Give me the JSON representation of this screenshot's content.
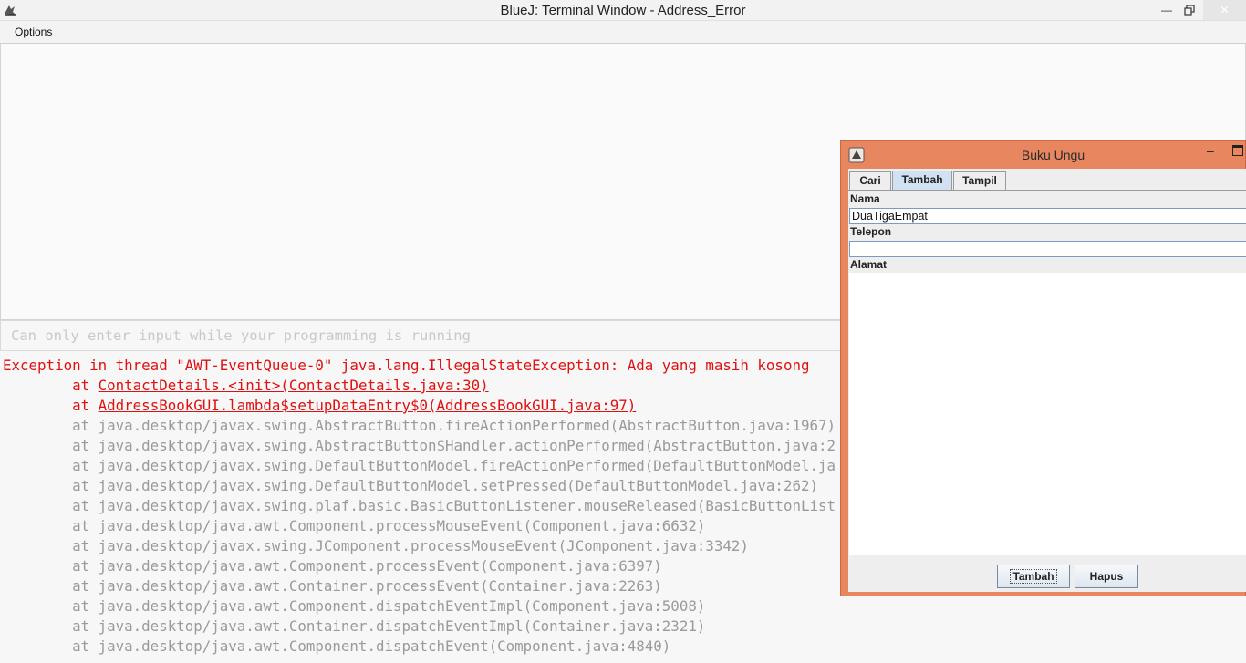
{
  "window": {
    "title": "BlueJ: Terminal Window - Address_Error",
    "minimize_label": "—",
    "close_label": "✕"
  },
  "menu": {
    "options_label": "Options"
  },
  "input": {
    "placeholder": "Can only enter input while your programming is running"
  },
  "error_lines": [
    {
      "text": "Exception in thread \"AWT-EventQueue-0\" java.lang.IllegalStateException: Ada yang masih kosong",
      "prefix": ""
    },
    {
      "prefix": "        at ",
      "link": "ContactDetails.<init>(ContactDetails.java:30)"
    },
    {
      "prefix": "        at ",
      "link": "AddressBookGUI.lambda$setupDataEntry$0(AddressBookGUI.java:97)"
    },
    {
      "text": "        at java.desktop/javax.swing.AbstractButton.fireActionPerformed(AbstractButton.java:1967)"
    },
    {
      "text": "        at java.desktop/javax.swing.AbstractButton$Handler.actionPerformed(AbstractButton.java:2"
    },
    {
      "text": "        at java.desktop/javax.swing.DefaultButtonModel.fireActionPerformed(DefaultButtonModel.ja"
    },
    {
      "text": "        at java.desktop/javax.swing.DefaultButtonModel.setPressed(DefaultButtonModel.java:262)"
    },
    {
      "text": "        at java.desktop/javax.swing.plaf.basic.BasicButtonListener.mouseReleased(BasicButtonList"
    },
    {
      "text": "        at java.desktop/java.awt.Component.processMouseEvent(Component.java:6632)"
    },
    {
      "text": "        at java.desktop/javax.swing.JComponent.processMouseEvent(JComponent.java:3342)"
    },
    {
      "text": "        at java.desktop/java.awt.Component.processEvent(Component.java:6397)"
    },
    {
      "text": "        at java.desktop/java.awt.Container.processEvent(Container.java:2263)"
    },
    {
      "text": "        at java.desktop/java.awt.Component.dispatchEventImpl(Component.java:5008)"
    },
    {
      "text": "        at java.desktop/java.awt.Container.dispatchEventImpl(Container.java:2321)"
    },
    {
      "text": "        at java.desktop/java.awt.Component.dispatchEvent(Component.java:4840)"
    }
  ],
  "dialog": {
    "title": "Buku Ungu",
    "minimize_label": "–",
    "tabs": [
      "Cari",
      "Tambah",
      "Tampil"
    ],
    "active_tab": "Tambah",
    "fields": {
      "nama_label": "Nama",
      "nama_value": "DuaTigaEmpat",
      "telepon_label": "Telepon",
      "telepon_value": "",
      "alamat_label": "Alamat",
      "alamat_value": ""
    },
    "buttons": {
      "tambah": "Tambah",
      "hapus": "Hapus"
    }
  },
  "colors": {
    "error_red": "#e01010",
    "trace_grey": "#9a9a9a",
    "dialog_frame": "#e8875f",
    "active_tab": "#cfe1f3"
  }
}
